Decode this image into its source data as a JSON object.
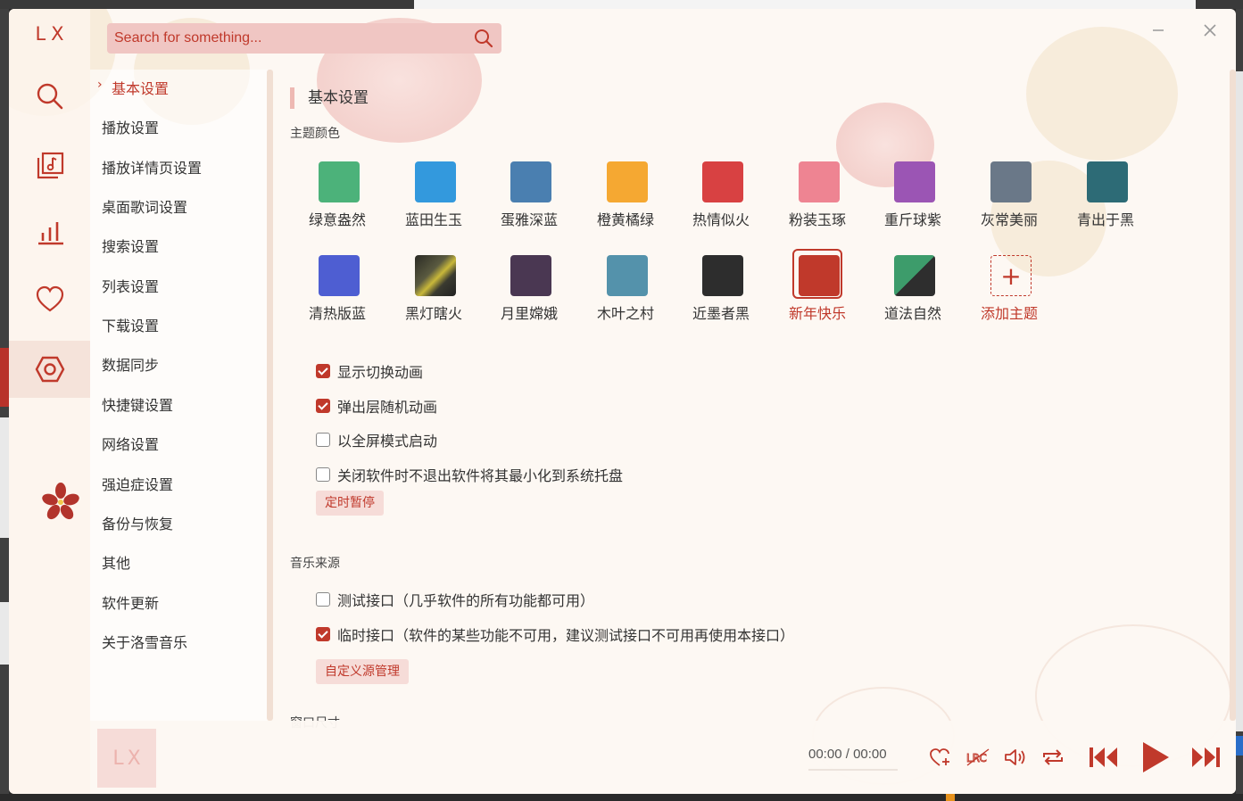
{
  "app": {
    "logo": "LX",
    "search_placeholder": "Search for something...",
    "accent_color": "#c0392b"
  },
  "sidebar": {
    "icons": [
      {
        "name": "search-icon"
      },
      {
        "name": "song-list-icon"
      },
      {
        "name": "leaderboard-icon"
      },
      {
        "name": "heart-icon"
      },
      {
        "name": "settings-icon",
        "active": true
      }
    ]
  },
  "settings_nav": {
    "items": [
      {
        "label": "基本设置",
        "active": true
      },
      {
        "label": "播放设置"
      },
      {
        "label": "播放详情页设置"
      },
      {
        "label": "桌面歌词设置"
      },
      {
        "label": "搜索设置"
      },
      {
        "label": "列表设置"
      },
      {
        "label": "下载设置"
      },
      {
        "label": "数据同步"
      },
      {
        "label": "快捷键设置"
      },
      {
        "label": "网络设置"
      },
      {
        "label": "强迫症设置"
      },
      {
        "label": "备份与恢复"
      },
      {
        "label": "其他"
      },
      {
        "label": "软件更新"
      },
      {
        "label": "关于洛雪音乐"
      }
    ]
  },
  "basic": {
    "section_title": "基本设置",
    "theme_label": "主题颜色",
    "themes": [
      {
        "name": "绿意盎然",
        "color": "#4cb27a"
      },
      {
        "name": "蓝田生玉",
        "color": "#3399dd"
      },
      {
        "name": "蛋雅深蓝",
        "color": "#4a7fb0"
      },
      {
        "name": "橙黄橘绿",
        "color": "#f5a832"
      },
      {
        "name": "热情似火",
        "color": "#d84142"
      },
      {
        "name": "粉装玉琢",
        "color": "#ee8492"
      },
      {
        "name": "重斤球紫",
        "color": "#9b55b4"
      },
      {
        "name": "灰常美丽",
        "color": "#6a7888"
      },
      {
        "name": "青出于黑",
        "color": "#2d6b76"
      },
      {
        "name": "清热版蓝",
        "color": "#4e5ed2"
      },
      {
        "name": "黑灯瞎火",
        "color": "#3a3a30"
      },
      {
        "name": "月里嫦娥",
        "color": "#4a3752"
      },
      {
        "name": "木叶之村",
        "color": "#5492ab"
      },
      {
        "name": "近墨者黑",
        "color": "#2d2d2d"
      },
      {
        "name": "新年快乐",
        "color": "#c0392b",
        "selected": true
      },
      {
        "name": "道法自然",
        "color": "#3d9c6b"
      },
      {
        "name": "添加主题",
        "add": true
      }
    ],
    "options": [
      {
        "label": "显示切换动画",
        "checked": true
      },
      {
        "label": "弹出层随机动画",
        "checked": true
      },
      {
        "label": "以全屏模式启动",
        "checked": false
      },
      {
        "label": "关闭软件时不退出软件将其最小化到系统托盘",
        "checked": false
      }
    ],
    "timer_button": "定时暂停",
    "music_source_label": "音乐来源",
    "sources": [
      {
        "label": "测试接口（几乎软件的所有功能都可用）",
        "checked": false
      },
      {
        "label": "临时接口（软件的某些功能不可用，建议测试接口不可用再使用本接口）",
        "checked": true
      }
    ],
    "custom_source_button": "自定义源管理",
    "window_size_label": "窗口尺寸"
  },
  "player": {
    "cover_text": "LX",
    "current_time": "00:00",
    "separator": "/",
    "total_time": "00:00"
  }
}
